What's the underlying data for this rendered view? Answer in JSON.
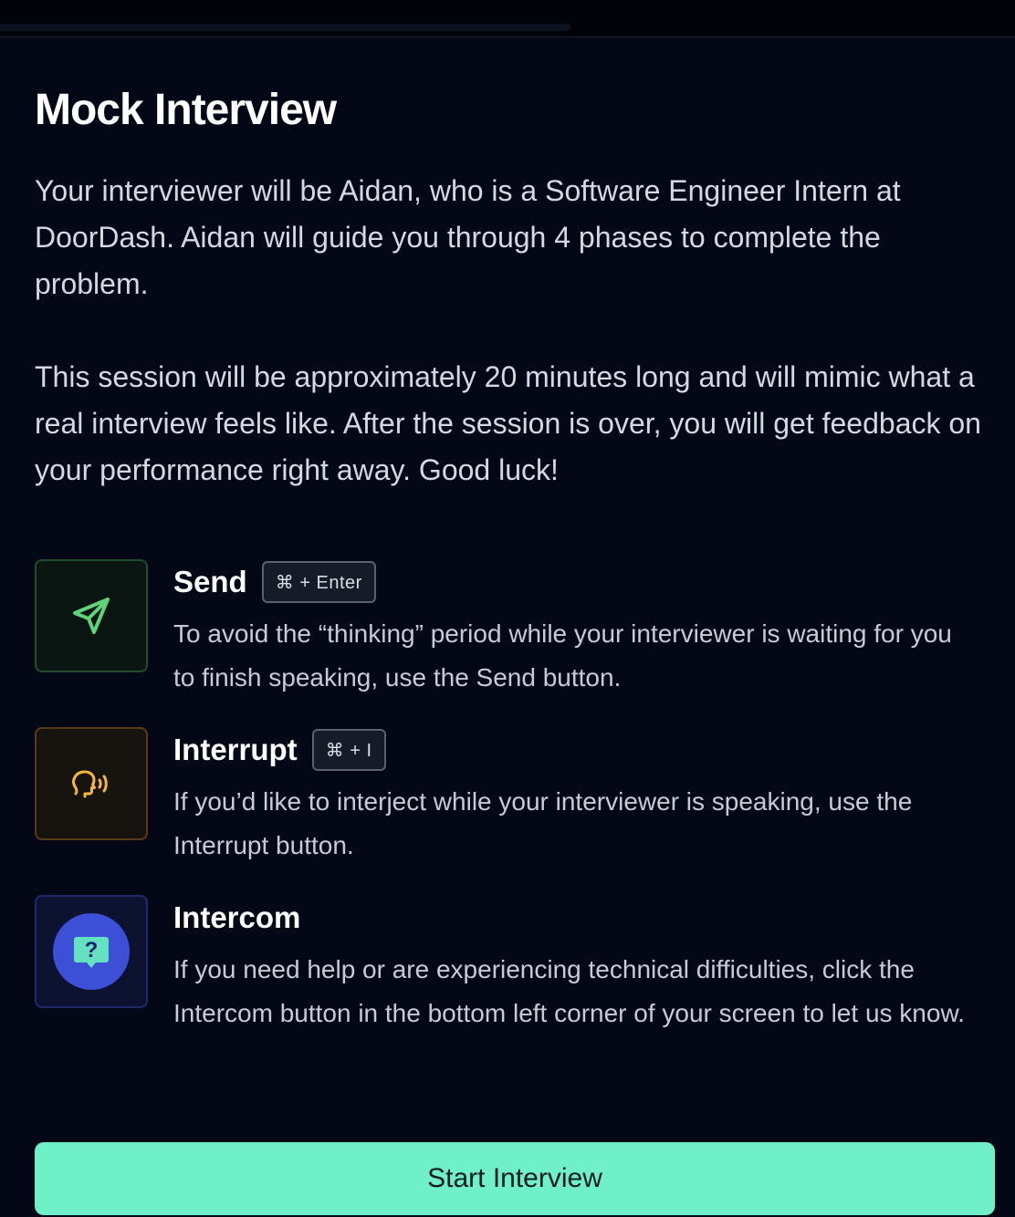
{
  "page": {
    "title": "Mock Interview",
    "intro_paragraphs": [
      "Your interviewer will be Aidan, who is a Software Engineer Intern at DoorDash. Aidan will guide you through 4 phases to complete the problem.",
      "This session will be approximately 20 minutes long and will mimic what a real interview feels like. After the session is over, you will get feedback on your performance right away. Good luck!"
    ]
  },
  "features": [
    {
      "title": "Send",
      "shortcut": "⌘ + Enter",
      "description": "To avoid the “thinking” period while your interviewer is waiting for you to finish speaking, use the Send button.",
      "icon": "send-icon",
      "accent": "#5fd27a"
    },
    {
      "title": "Interrupt",
      "shortcut": "⌘ + I",
      "description": "If you’d like to interject while your interviewer is speaking, use the Interrupt button.",
      "icon": "speaking-head-icon",
      "accent": "#f4b73a"
    },
    {
      "title": "Intercom",
      "shortcut": "",
      "description": "If you need help or are experiencing technical difficulties, click the Intercom button in the bottom left corner of your screen to let us know.",
      "icon": "help-chat-icon",
      "accent": "#3d4fd6"
    }
  ],
  "actions": {
    "start_label": "Start Interview"
  },
  "colors": {
    "background": "#040816",
    "primary_button": "#6ff0c8"
  }
}
